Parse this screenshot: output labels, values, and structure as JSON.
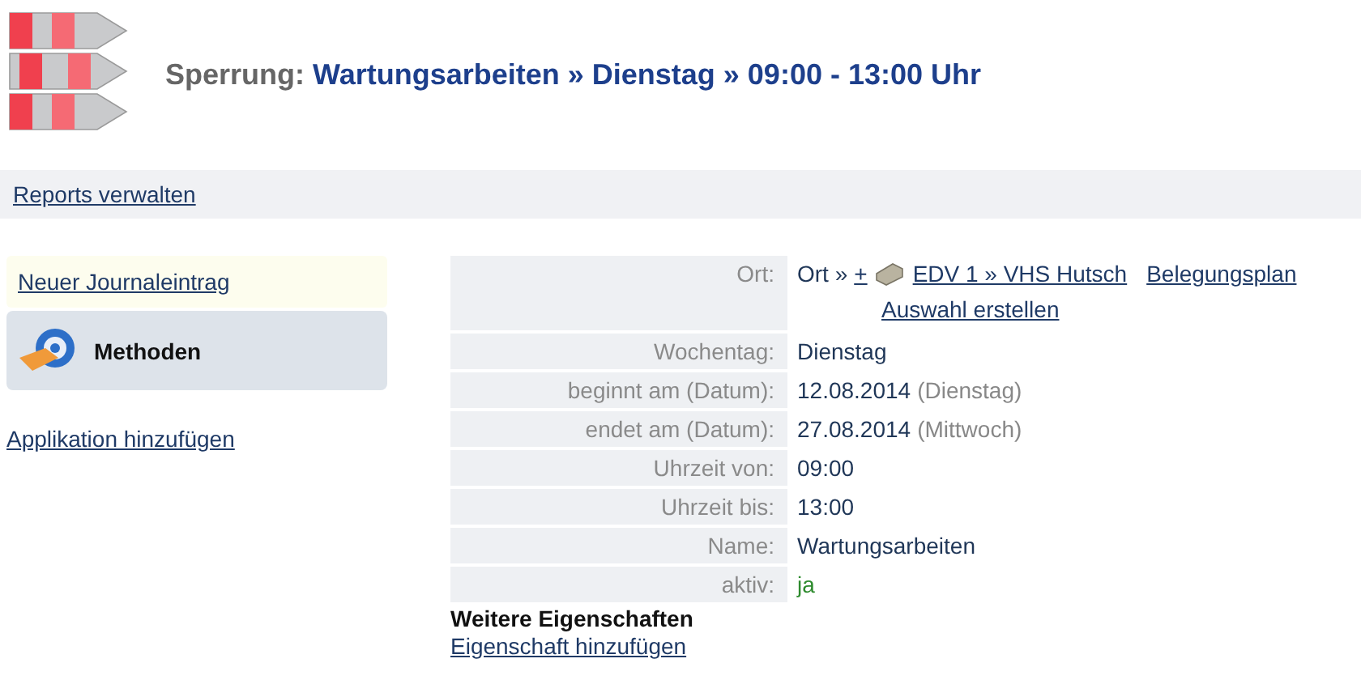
{
  "header": {
    "prefix": "Sperrung:",
    "title": "Wartungsarbeiten » Dienstag » 09:00 - 13:00 Uhr"
  },
  "toolbar": {
    "link": "Reports verwalten"
  },
  "sidebar": {
    "journal_link": "Neuer Journaleintrag",
    "methods_label": "Methoden",
    "add_app_link": "Applikation hinzufügen"
  },
  "location": {
    "label": "Ort:",
    "prefix": "Ort »",
    "plus": "+",
    "link": "EDV 1 » VHS Hutsch",
    "plan_link": "Belegungsplan",
    "select_link": "Auswahl erstellen"
  },
  "rows": [
    {
      "kind": "text",
      "label": "Wochentag:",
      "value": "Dienstag"
    },
    {
      "kind": "date",
      "label": "beginnt am (Datum):",
      "value": "12.08.2014",
      "note": "(Dienstag)"
    },
    {
      "kind": "date",
      "label": "endet am (Datum):",
      "value": "27.08.2014",
      "note": "(Mittwoch)"
    },
    {
      "kind": "text",
      "label": "Uhrzeit von:",
      "value": "09:00"
    },
    {
      "kind": "text",
      "label": "Uhrzeit bis:",
      "value": "13:00"
    },
    {
      "kind": "text",
      "label": "Name:",
      "value": "Wartungsarbeiten"
    },
    {
      "kind": "flag",
      "label": "aktiv:",
      "value": "ja"
    }
  ],
  "more": {
    "title": "Weitere Eigenschaften",
    "link": "Eigenschaft hinzufügen"
  }
}
